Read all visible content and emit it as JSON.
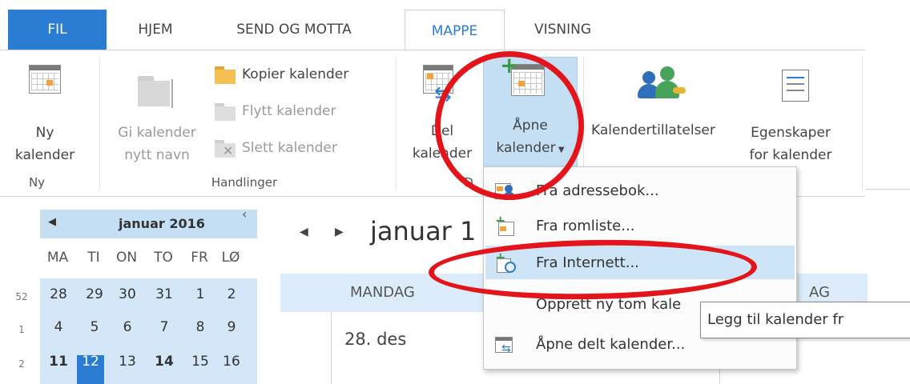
{
  "tabs": {
    "fil": "FIL",
    "hjem": "HJEM",
    "send_motta": "SEND OG MOTTA",
    "mappe": "MAPPE",
    "visning": "VISNING"
  },
  "ribbon": {
    "ny_kalender": [
      "Ny",
      "kalender"
    ],
    "group_ny": "Ny",
    "gi_nytt_navn": [
      "Gi kalender",
      "nytt navn"
    ],
    "kopier": "Kopier kalender",
    "flytt": "Flytt kalender",
    "slett": "Slett kalender",
    "group_handlinger": "Handlinger",
    "del_kalender": [
      "Del",
      "kalender"
    ],
    "apne_kalender": [
      "Åpne",
      "kalender"
    ],
    "group_del": "D",
    "kalendertillatelser": "Kalendertillatelser",
    "egenskaper": [
      "Egenskaper",
      "for kalender"
    ]
  },
  "dropdown": {
    "items": [
      {
        "label": "Fra adressebok...",
        "icon": "address-book-icon"
      },
      {
        "label": "Fra romliste...",
        "icon": "room-list-icon"
      },
      {
        "label": "Fra Internett...",
        "icon": "internet-calendar-icon"
      },
      {
        "label": "Opprett ny tom kale",
        "icon": ""
      },
      {
        "label": "Åpne delt kalender...",
        "icon": "shared-calendar-icon"
      }
    ],
    "tooltip": "Legg til kalender fr"
  },
  "minical": {
    "title": "januar 2016",
    "prev": "◀",
    "weekdays": [
      "MA",
      "TI",
      "ON",
      "TO",
      "FR",
      "LØ"
    ],
    "weeks": [
      {
        "week": "52",
        "days": [
          "28",
          "29",
          "30",
          "31",
          "1",
          "2"
        ]
      },
      {
        "week": "1",
        "days": [
          "4",
          "5",
          "6",
          "7",
          "8",
          "9"
        ]
      },
      {
        "week": "2",
        "days": [
          "11",
          "12",
          "13",
          "14",
          "15",
          "16"
        ]
      }
    ]
  },
  "calview": {
    "title": "januar 1",
    "header_day": "MANDAG",
    "header_day_right": "AG",
    "first_date": "28. des"
  },
  "colors": {
    "accent": "#2b7cd3",
    "highlight": "#c5dff5",
    "annotation_red": "#e4141b"
  }
}
